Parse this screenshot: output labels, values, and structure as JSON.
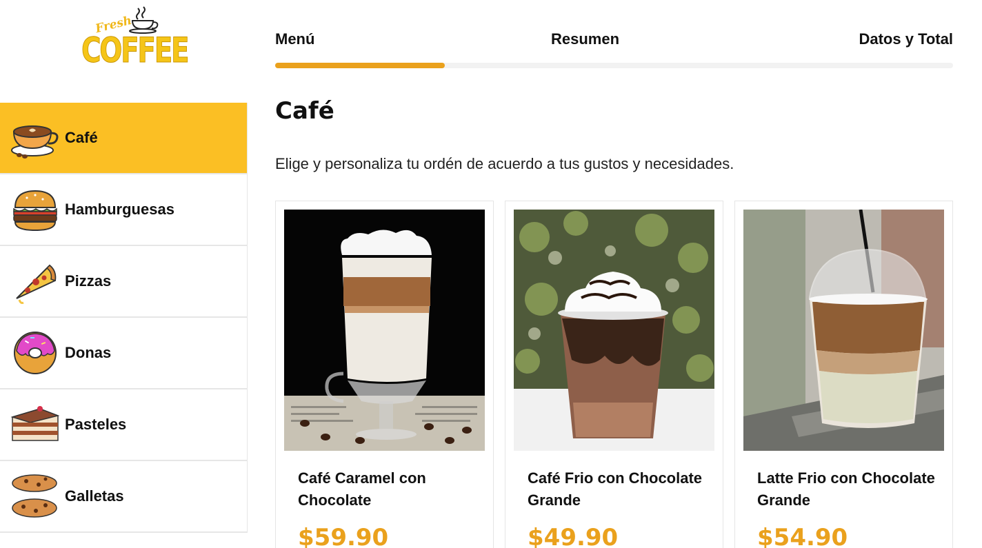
{
  "brand": {
    "script": "Fresh",
    "word": "COFFEE",
    "primary_color": "#fbbf24",
    "accent_color": "#eaa11d"
  },
  "categories": [
    {
      "label": "Café",
      "icon": "coffee-cup-icon",
      "active": true
    },
    {
      "label": "Hamburguesas",
      "icon": "burger-icon",
      "active": false
    },
    {
      "label": "Pizzas",
      "icon": "pizza-icon",
      "active": false
    },
    {
      "label": "Donas",
      "icon": "donut-icon",
      "active": false
    },
    {
      "label": "Pasteles",
      "icon": "cake-icon",
      "active": false
    },
    {
      "label": "Galletas",
      "icon": "cookie-icon",
      "active": false
    }
  ],
  "steps": {
    "items": [
      "Menú",
      "Resumen",
      "Datos y Total"
    ],
    "progress_fraction": 0.25
  },
  "main": {
    "heading": "Café",
    "subtitle": "Elige y personaliza tu ordén de acuerdo a tus gustos y necesidades."
  },
  "products": [
    {
      "name": "Café Caramel con Chocolate",
      "price": "$59.90",
      "image": "latte-macchiato-photo"
    },
    {
      "name": "Café Frio con Chocolate Grande",
      "price": "$49.90",
      "image": "frappe-photo"
    },
    {
      "name": "Latte Frio con Chocolate Grande",
      "price": "$54.90",
      "image": "iced-latte-photo"
    }
  ]
}
